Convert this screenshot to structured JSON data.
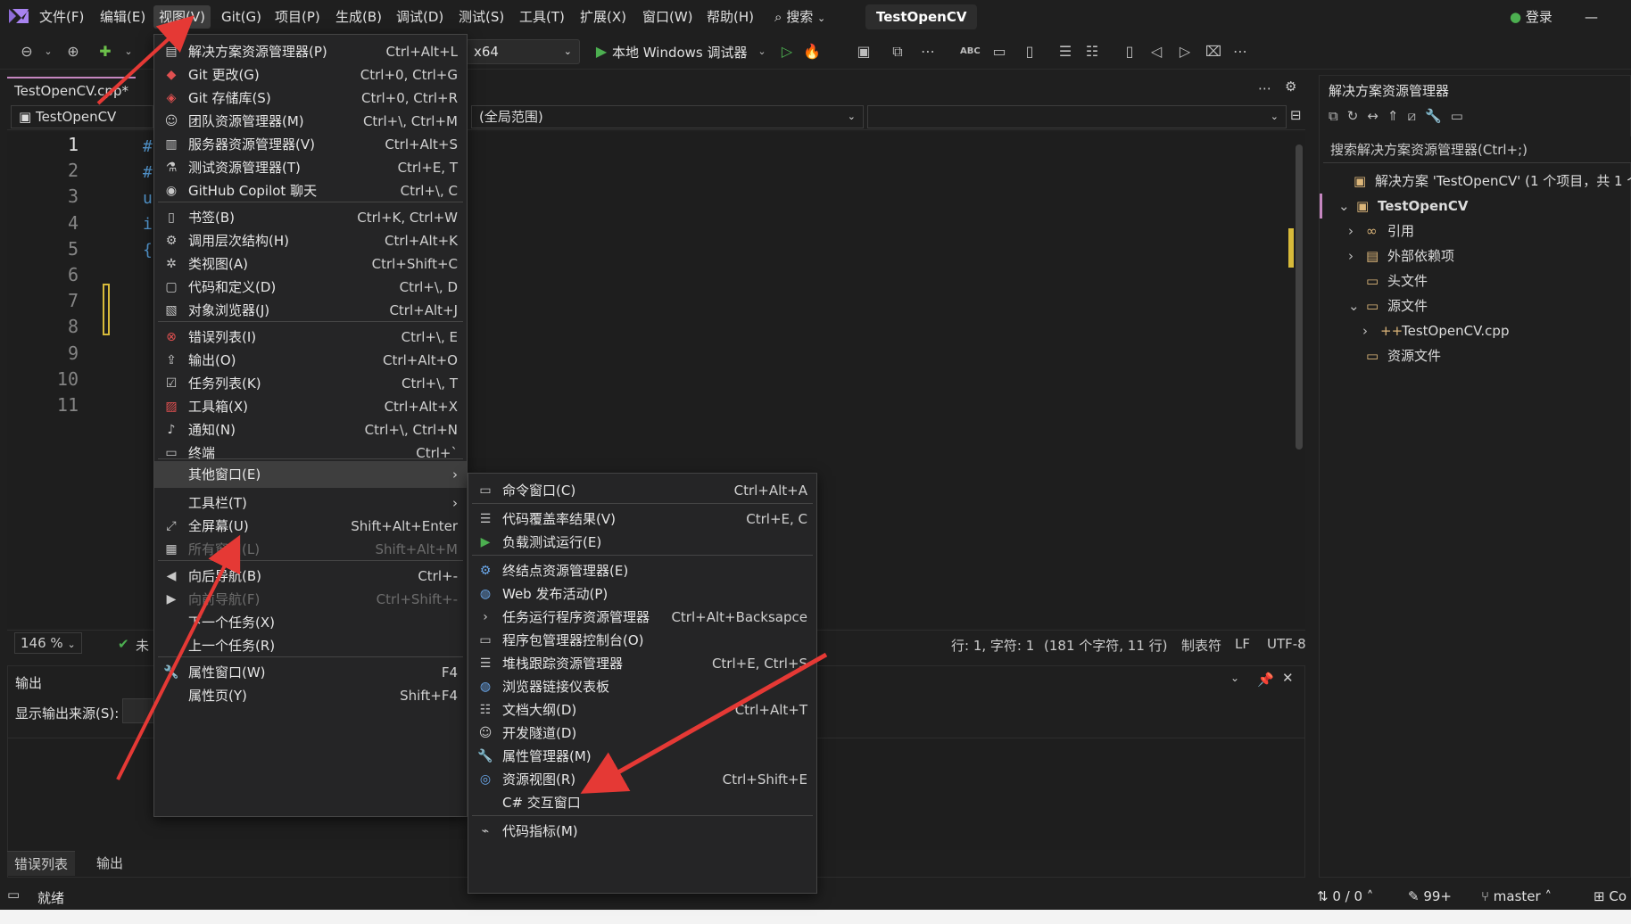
{
  "app": {
    "title": "TestOpenCV",
    "login": "登录",
    "minimize": "—"
  },
  "menubar": [
    "文件(F)",
    "编辑(E)",
    "视图(V)",
    "Git(G)",
    "项目(P)",
    "生成(B)",
    "调试(D)",
    "测试(S)",
    "工具(T)",
    "扩展(X)",
    "窗口(W)",
    "帮助(H)"
  ],
  "search_label": "搜索",
  "toolbar": {
    "platform": "x64",
    "run_label": "本地 Windows 调试器"
  },
  "editor": {
    "tab": "TestOpenCV.cpp*",
    "project_combo": "TestOpenCV",
    "scope_combo": "(全局范围)",
    "line_numbers": [
      "1",
      "2",
      "3",
      "4",
      "5",
      "6",
      "7",
      "8",
      "9",
      "10",
      "11"
    ],
    "zoom": "146 %",
    "status_short": "未",
    "position": "行: 1, 字符: 1",
    "info": "(181 个字符, 11 行)",
    "tabs": "制表符",
    "eol": "LF",
    "encoding": "UTF-8"
  },
  "output": {
    "title": "输出",
    "source_label": "显示输出来源(S):",
    "tabs": [
      "错误列表",
      "输出"
    ]
  },
  "solution": {
    "title": "解决方案资源管理器",
    "search": "搜索解决方案资源管理器(Ctrl+;)",
    "tree": [
      {
        "label": "解决方案 'TestOpenCV' (1 个项目，共 1 个"
      },
      {
        "label": "TestOpenCV"
      },
      {
        "label": "引用"
      },
      {
        "label": "外部依赖项"
      },
      {
        "label": "头文件"
      },
      {
        "label": "源文件"
      },
      {
        "label": "TestOpenCV.cpp"
      },
      {
        "label": "资源文件"
      }
    ]
  },
  "view_menu": [
    {
      "label": "解决方案资源管理器(P)",
      "shortcut": "Ctrl+Alt+L",
      "icon": "solution-explorer-icon"
    },
    {
      "label": "Git 更改(G)",
      "shortcut": "Ctrl+0, Ctrl+G",
      "icon": "git-changes-icon"
    },
    {
      "label": "Git 存储库(S)",
      "shortcut": "Ctrl+0, Ctrl+R",
      "icon": "git-repository-icon"
    },
    {
      "label": "团队资源管理器(M)",
      "shortcut": "Ctrl+\\, Ctrl+M",
      "icon": "team-explorer-icon"
    },
    {
      "label": "服务器资源管理器(V)",
      "shortcut": "Ctrl+Alt+S",
      "icon": "server-explorer-icon"
    },
    {
      "label": "测试资源管理器(T)",
      "shortcut": "Ctrl+E, T",
      "icon": "test-explorer-icon"
    },
    {
      "label": "GitHub Copilot 聊天",
      "shortcut": "Ctrl+\\, C",
      "icon": "copilot-icon"
    },
    {
      "label": "书签(B)",
      "shortcut": "Ctrl+K, Ctrl+W",
      "icon": "bookmark-icon"
    },
    {
      "label": "调用层次结构(H)",
      "shortcut": "Ctrl+Alt+K",
      "icon": "call-hierarchy-icon"
    },
    {
      "label": "类视图(A)",
      "shortcut": "Ctrl+Shift+C",
      "icon": "class-view-icon"
    },
    {
      "label": "代码和定义(D)",
      "shortcut": "Ctrl+\\, D",
      "icon": "code-definition-icon"
    },
    {
      "label": "对象浏览器(J)",
      "shortcut": "Ctrl+Alt+J",
      "icon": "object-browser-icon"
    },
    {
      "label": "错误列表(I)",
      "shortcut": "Ctrl+\\, E",
      "icon": "error-list-icon"
    },
    {
      "label": "输出(O)",
      "shortcut": "Ctrl+Alt+O",
      "icon": "output-icon"
    },
    {
      "label": "任务列表(K)",
      "shortcut": "Ctrl+\\, T",
      "icon": "task-list-icon"
    },
    {
      "label": "工具箱(X)",
      "shortcut": "Ctrl+Alt+X",
      "icon": "toolbox-icon"
    },
    {
      "label": "通知(N)",
      "shortcut": "Ctrl+\\, Ctrl+N",
      "icon": "bell-icon"
    },
    {
      "label": "终端",
      "shortcut": "Ctrl+`",
      "icon": "terminal-icon"
    },
    {
      "label": "其他窗口(E)",
      "shortcut": "",
      "icon": ""
    },
    {
      "label": "工具栏(T)",
      "shortcut": "",
      "icon": ""
    },
    {
      "label": "全屏幕(U)",
      "shortcut": "Shift+Alt+Enter",
      "icon": "fullscreen-icon"
    },
    {
      "label": "所有窗口(L)",
      "shortcut": "Shift+Alt+M",
      "icon": "all-windows-icon"
    },
    {
      "label": "向后导航(B)",
      "shortcut": "Ctrl+-",
      "icon": "navigate-back-icon"
    },
    {
      "label": "向前导航(F)",
      "shortcut": "Ctrl+Shift+-",
      "icon": "navigate-forward-icon"
    },
    {
      "label": "下一个任务(X)",
      "shortcut": "",
      "icon": ""
    },
    {
      "label": "上一个任务(R)",
      "shortcut": "",
      "icon": ""
    },
    {
      "label": "属性窗口(W)",
      "shortcut": "F4",
      "icon": "wrench-icon"
    },
    {
      "label": "属性页(Y)",
      "shortcut": "Shift+F4",
      "icon": ""
    }
  ],
  "other_windows_menu": [
    {
      "label": "命令窗口(C)",
      "shortcut": "Ctrl+Alt+A"
    },
    {
      "label": "代码覆盖率结果(V)",
      "shortcut": "Ctrl+E, C"
    },
    {
      "label": "负载测试运行(E)",
      "shortcut": ""
    },
    {
      "label": "终结点资源管理器(E)",
      "shortcut": ""
    },
    {
      "label": "Web 发布活动(P)",
      "shortcut": ""
    },
    {
      "label": "任务运行程序资源管理器",
      "shortcut": "Ctrl+Alt+Backsapce"
    },
    {
      "label": "程序包管理器控制台(O)",
      "shortcut": ""
    },
    {
      "label": "堆栈跟踪资源管理器",
      "shortcut": "Ctrl+E, Ctrl+S"
    },
    {
      "label": "浏览器链接仪表板",
      "shortcut": ""
    },
    {
      "label": "文档大纲(D)",
      "shortcut": "Ctrl+Alt+T"
    },
    {
      "label": "开发隧道(D)",
      "shortcut": ""
    },
    {
      "label": "属性管理器(M)",
      "shortcut": ""
    },
    {
      "label": "资源视图(R)",
      "shortcut": "Ctrl+Shift+E"
    },
    {
      "label": "C# 交互窗口",
      "shortcut": ""
    },
    {
      "label": "代码指标(M)",
      "shortcut": ""
    }
  ],
  "statusbar": {
    "ready": "就绪",
    "changes": "0 / 0",
    "edits": "99+",
    "branch": "master",
    "extra": "Co"
  },
  "colors": {
    "accent": "#c586c0",
    "arrow": "#e53935",
    "menu_bg": "#252526"
  }
}
